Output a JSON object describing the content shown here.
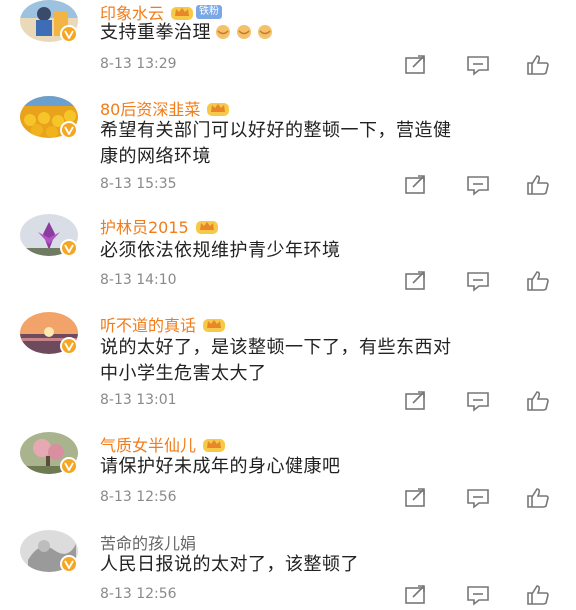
{
  "comments": [
    {
      "username": "印象水云",
      "fans_badge": "铁粉",
      "text": "支持重拳治理",
      "emoji_count": 3,
      "time": "8-13 13:29",
      "name_color": "orange"
    },
    {
      "username": "80后资深韭菜",
      "text_line1": "希望有关部门可以好好的整顿一下，营造健",
      "text_line2": "康的网络环境",
      "time": "8-13 15:35"
    },
    {
      "username": "护林员2015",
      "text": "必须依法依规维护青少年环境",
      "time": "8-13 14:10"
    },
    {
      "username": "听不道的真话",
      "text_line1": "说的太好了，是该整顿一下了，有些东西对",
      "text_line2": "中小学生危害太大了",
      "time": "8-13 13:01"
    },
    {
      "username": "气质女半仙儿",
      "text": "请保护好未成年的身心健康吧",
      "time": "8-13 12:56"
    },
    {
      "username": "苦命的孩儿娟",
      "text": "人民日报说的太对了，该整顿了",
      "time": "8-13 12:56"
    }
  ],
  "colors": {
    "username_vip": "#f07c1a",
    "username_plain": "#666666",
    "time": "#8a8a8a",
    "badge": "#f5a623"
  },
  "icons": [
    "share-icon",
    "comment-icon",
    "like-icon",
    "crown-icon",
    "verified-badge-icon"
  ]
}
